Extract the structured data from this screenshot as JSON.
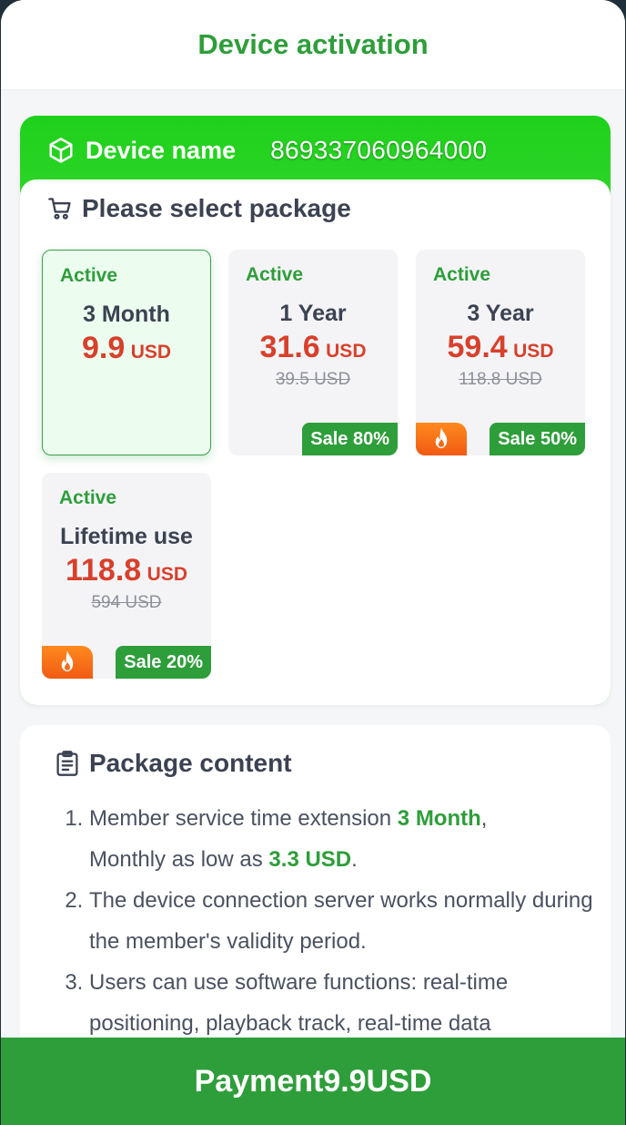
{
  "header": {
    "title": "Device activation"
  },
  "device": {
    "label": "Device name",
    "id": "869337060964000",
    "icon": "cube-icon"
  },
  "packages_panel": {
    "title": "Please select package",
    "icon": "cart-icon",
    "items": [
      {
        "status": "Active",
        "name": "3 Month",
        "price": "9.9",
        "currency": "USD",
        "original": "",
        "sale": "",
        "hot": false,
        "selected": true
      },
      {
        "status": "Active",
        "name": "1 Year",
        "price": "31.6",
        "currency": "USD",
        "original": "39.5 USD",
        "sale": "Sale 80%",
        "hot": false,
        "selected": false
      },
      {
        "status": "Active",
        "name": "3 Year",
        "price": "59.4",
        "currency": "USD",
        "original": "118.8 USD",
        "sale": "Sale 50%",
        "hot": true,
        "selected": false
      },
      {
        "status": "Active",
        "name": "Lifetime use",
        "price": "118.8",
        "currency": "USD",
        "original": "594 USD",
        "sale": "Sale 20%",
        "hot": true,
        "selected": false
      }
    ]
  },
  "content": {
    "title": "Package content",
    "icon": "clipboard-icon",
    "item1": {
      "text_a": "Member service time extension ",
      "highlight_a": "3 Month",
      "text_b": ",",
      "text_c": "Monthly as low as ",
      "highlight_b": "3.3 USD",
      "text_d": "."
    },
    "item2": "The device connection server works normally during the member's validity period.",
    "item3": "Users can use software functions: real-time positioning, playback track, real-time data"
  },
  "payment": {
    "label": "Payment",
    "amount": "9.9",
    "currency": "USD"
  },
  "colors": {
    "accent_green": "#2e9e3a",
    "price_red": "#d8402b",
    "header_green_gradient": "#1ed11b"
  }
}
